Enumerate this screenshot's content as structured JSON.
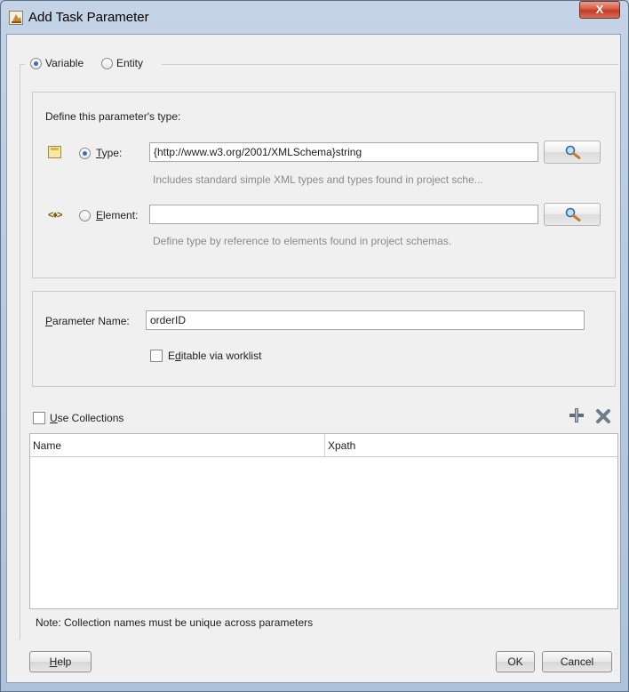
{
  "window": {
    "title": "Add Task Parameter",
    "close_symbol": "X"
  },
  "mode": {
    "variable_label": "Variable",
    "entity_label": "Entity",
    "selected": "Variable"
  },
  "type_section": {
    "heading": "Define this parameter's type:",
    "type_option": {
      "label_underlined": "T",
      "label_rest": "ype:",
      "value": "{http://www.w3.org/2001/XMLSchema}string",
      "hint": "Includes standard simple XML types and types found in project sche...",
      "selected": true
    },
    "element_option": {
      "label_underlined": "E",
      "label_rest": "lement:",
      "value": "",
      "hint": "Define type by reference to elements found in project schemas.",
      "selected": false
    }
  },
  "parameter": {
    "name_label_underlined": "P",
    "name_label_rest": "arameter Name:",
    "name_value": "orderID",
    "editable_label_pre": "E",
    "editable_label_underlined": "d",
    "editable_label_rest": "itable via worklist",
    "editable_checked": false
  },
  "collections": {
    "use_label_underlined": "U",
    "use_label_rest": "se Collections",
    "use_checked": false,
    "columns": [
      "Name",
      "Xpath"
    ],
    "rows": [],
    "note": "Note: Collection names must be unique across parameters"
  },
  "buttons": {
    "help_underlined": "H",
    "help_rest": "elp",
    "ok": "OK",
    "cancel": "Cancel"
  },
  "colors": {
    "accent": "#3a6fb6",
    "add_icon": "#5d6e7f",
    "remove_icon": "#6f7d8b",
    "close_button": "#c03a22"
  }
}
